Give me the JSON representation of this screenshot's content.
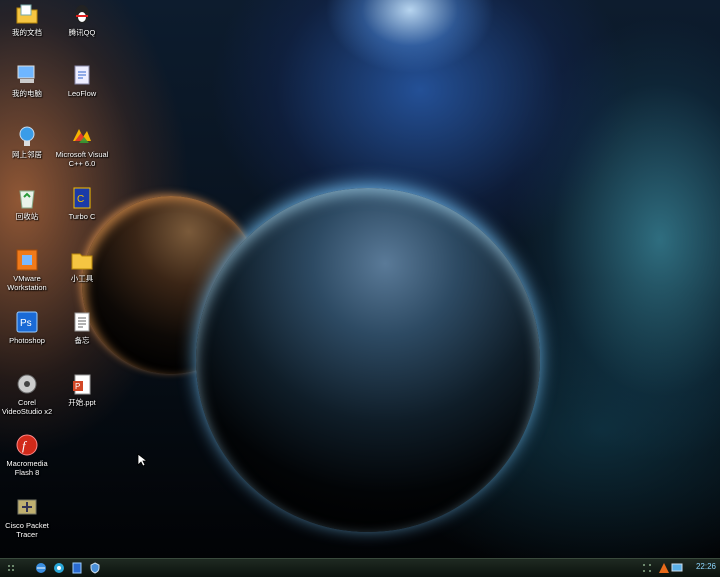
{
  "desktop": {
    "icons": [
      {
        "label": "我的文档"
      },
      {
        "label": "我的电脑"
      },
      {
        "label": "网上邻居"
      },
      {
        "label": "回收站"
      },
      {
        "label": "VMware\nWorkstation"
      },
      {
        "label": "Photoshop"
      },
      {
        "label": "Corel\nVideoStudio x2"
      },
      {
        "label": "Macromedia\nFlash 8"
      },
      {
        "label": "Cisco Packet\nTracer"
      },
      {
        "label": "腾讯QQ"
      },
      {
        "label": "LeoFlow"
      },
      {
        "label": "Microsoft Visual\nC++ 6.0"
      },
      {
        "label": "Turbo C"
      },
      {
        "label": "小工具"
      },
      {
        "label": "备忘"
      },
      {
        "label": "开始.ppt"
      }
    ]
  },
  "taskbar": {
    "quicklaunch": [
      {
        "icon": "ie-icon"
      },
      {
        "icon": "explorer-icon"
      },
      {
        "icon": "book-icon"
      },
      {
        "icon": "shield-icon"
      }
    ],
    "clock": "22:26"
  },
  "colors": {
    "accent": "#8fd7ff",
    "taskbar": "#0b120d"
  }
}
